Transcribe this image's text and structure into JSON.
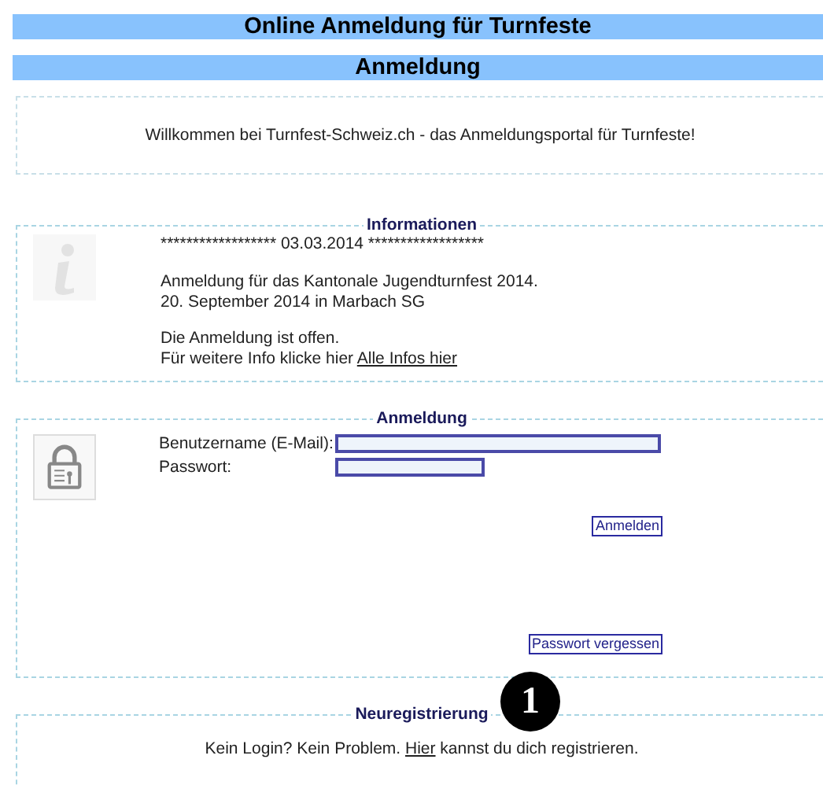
{
  "page_title": "Online Anmeldung für Turnfeste",
  "section_title": "Anmeldung",
  "welcome": "Willkommen bei Turnfest-Schweiz.ch - das Anmeldungsportal für Turnfeste!",
  "info": {
    "legend": "Informationen",
    "date_line": "****************** 03.03.2014 ******************",
    "event_lines": [
      "Anmeldung für das Kantonale Jugendturnfest 2014.",
      "20. September 2014 in Marbach SG"
    ],
    "status": "Die Anmeldung ist offen.",
    "more": {
      "before": "Für weitere Info klicke hier ",
      "link": "Alle Infos hier"
    }
  },
  "login": {
    "legend": "Anmeldung",
    "fields": [
      {
        "label": "Benutzername (E-Mail):",
        "kind": "text"
      },
      {
        "label": "Passwort:",
        "kind": "password"
      }
    ],
    "submit": "Anmelden",
    "forgot": "Passwort vergessen"
  },
  "register": {
    "legend": "Neuregistrierung",
    "text": {
      "before": "Kein Login? Kein Problem. ",
      "link": "Hier",
      "after": " kannst du dich registrieren."
    }
  },
  "callout": "1"
}
